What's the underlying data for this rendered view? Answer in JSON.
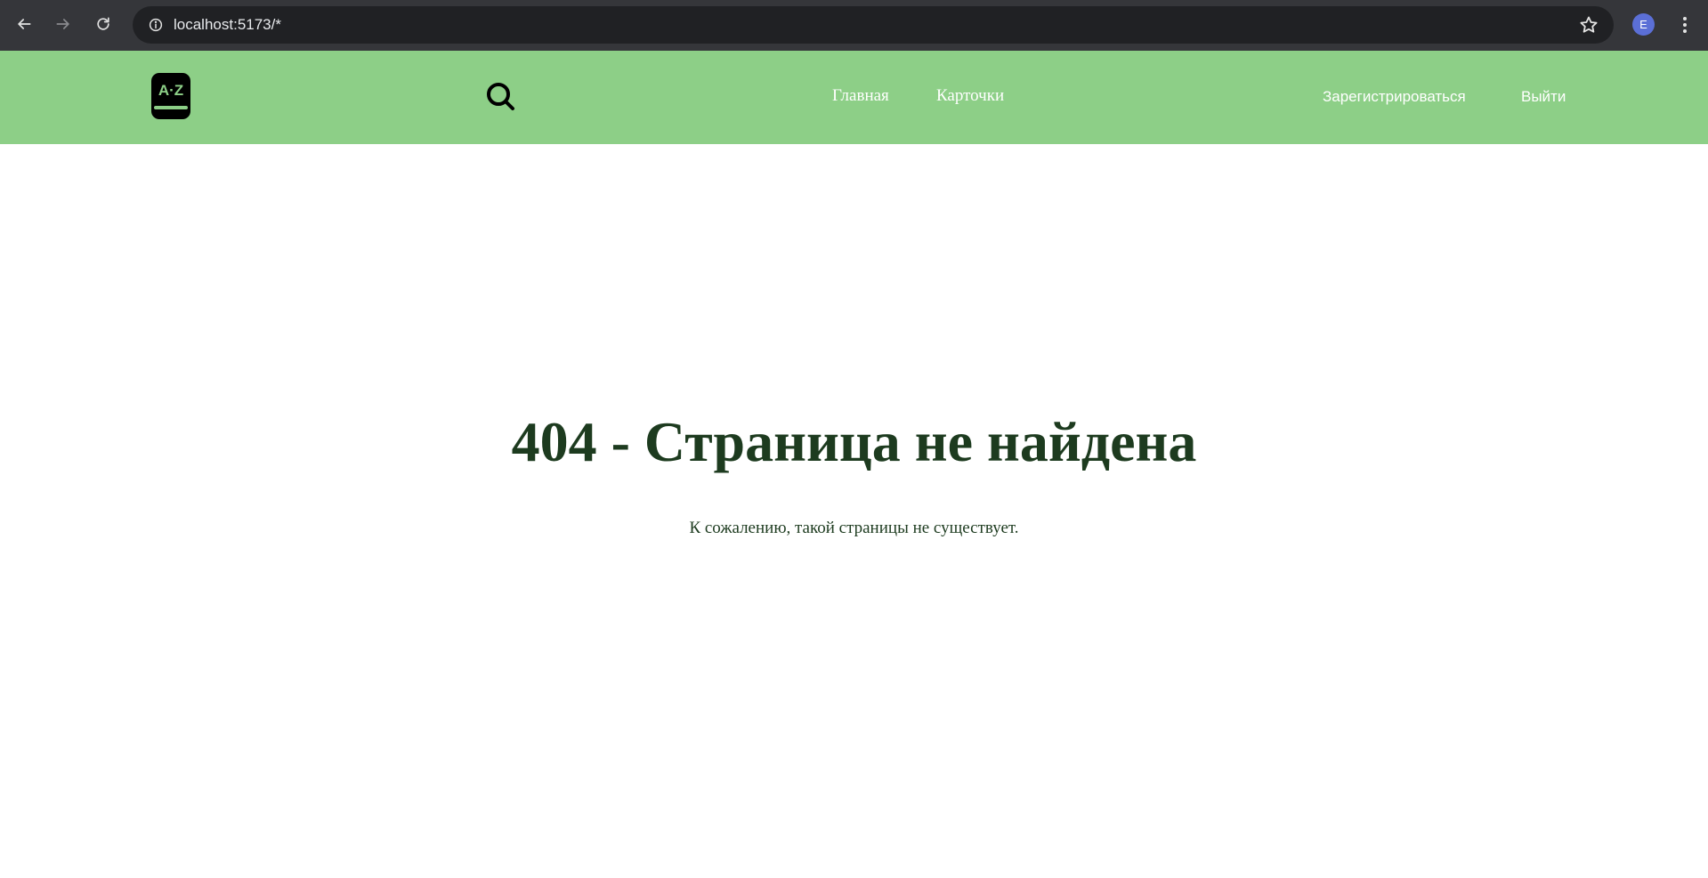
{
  "browser": {
    "url": "localhost:5173/*",
    "profile_initial": "E",
    "icons": {
      "back": "arrow-left-icon",
      "forward": "arrow-right-icon",
      "reload": "reload-icon",
      "site_info": "info-icon",
      "bookmark": "star-icon",
      "menu": "kebab-menu-icon"
    }
  },
  "header": {
    "logo_text": "A·Z",
    "nav": {
      "home": "Главная",
      "cards": "Карточки"
    },
    "auth": {
      "register": "Зарегистрироваться",
      "logout": "Выйти"
    },
    "colors": {
      "background": "#8dcf87",
      "link": "#ffffff"
    }
  },
  "main": {
    "title": "404 - Страница не найдена",
    "message": "К сожалению, такой страницы не существует.",
    "text_color": "#1d3b1f"
  }
}
